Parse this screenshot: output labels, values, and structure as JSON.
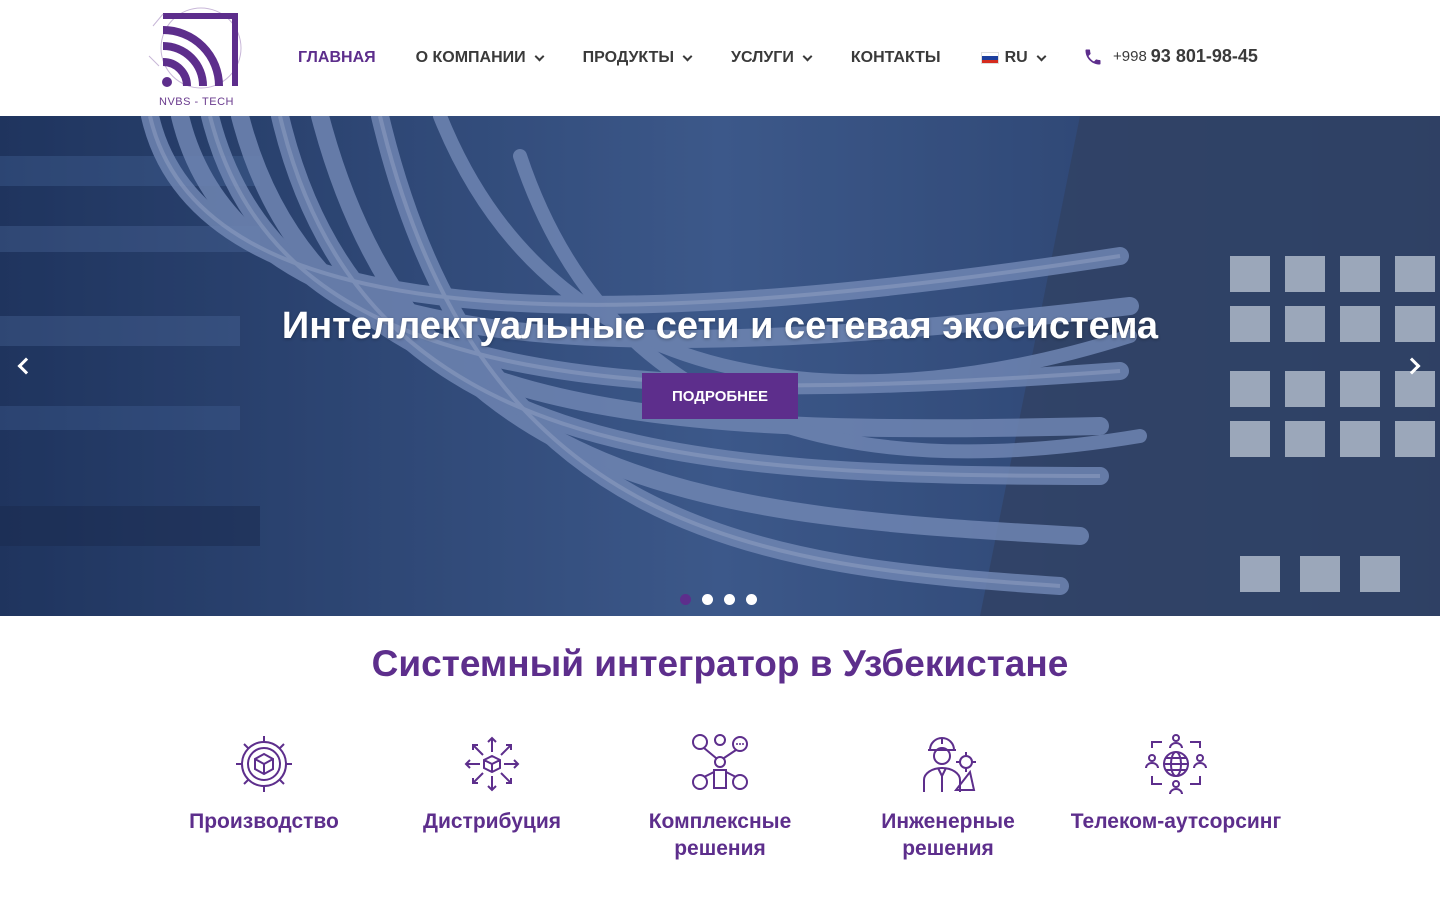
{
  "header": {
    "logo_text": "NVBS - TECH",
    "nav": [
      {
        "label": "ГЛАВНАЯ",
        "active": true,
        "dropdown": false
      },
      {
        "label": "О КОМПАНИИ",
        "active": false,
        "dropdown": true
      },
      {
        "label": "ПРОДУКТЫ",
        "active": false,
        "dropdown": true
      },
      {
        "label": "УСЛУГИ",
        "active": false,
        "dropdown": true
      },
      {
        "label": "КОНТАКТЫ",
        "active": false,
        "dropdown": false
      }
    ],
    "language": "RU",
    "phone_code": "+998",
    "phone_number": "93 801-98-45"
  },
  "hero": {
    "title": "Интеллектуальные сети и сетевая экосистема",
    "button_label": "ПОДРОБНЕЕ",
    "slide_count": 4,
    "active_slide": 1
  },
  "section": {
    "title": "Системный интегратор в Узбекистане",
    "features": [
      {
        "label": "Производство",
        "icon": "gear-cube-icon"
      },
      {
        "label": "Дистрибуция",
        "icon": "distribution-arrows-icon"
      },
      {
        "label": "Комплексные решения",
        "icon": "solutions-network-icon"
      },
      {
        "label": "Инженерные решения",
        "icon": "engineer-icon"
      },
      {
        "label": "Телеком-аутсорсинг",
        "icon": "telecom-globe-icon"
      }
    ]
  },
  "colors": {
    "brand": "#5d2e8c",
    "nav_text": "#3a3a3a"
  }
}
